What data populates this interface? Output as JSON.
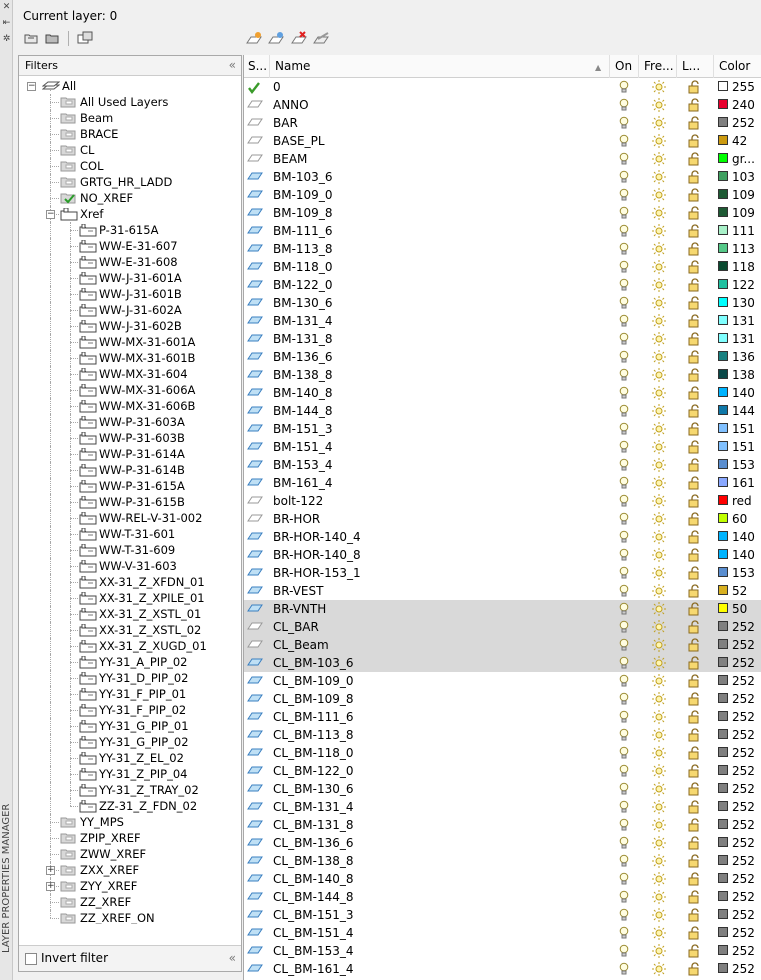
{
  "panel_title": "LAYER PROPERTIES MANAGER",
  "current_layer": "Current layer: 0",
  "filters": {
    "header": "Filters",
    "invert_filter": "Invert filter",
    "items": [
      {
        "label": "All",
        "level": 0,
        "icon": "layer-stack-icon",
        "expander": "minus"
      },
      {
        "label": "All Used Layers",
        "level": 1,
        "icon": "filter-folder-icon"
      },
      {
        "label": "Beam",
        "level": 1,
        "icon": "filter-folder-icon"
      },
      {
        "label": "BRACE",
        "level": 1,
        "icon": "filter-folder-icon"
      },
      {
        "label": "CL",
        "level": 1,
        "icon": "filter-folder-icon"
      },
      {
        "label": "COL",
        "level": 1,
        "icon": "filter-folder-icon"
      },
      {
        "label": "GRTG_HR_LADD",
        "level": 1,
        "icon": "filter-folder-icon"
      },
      {
        "label": "NO_XREF",
        "level": 1,
        "icon": "filter-folder-check-icon"
      },
      {
        "label": "Xref",
        "level": 1,
        "icon": "xref-folder-icon",
        "expander": "minus"
      },
      {
        "label": "P-31-615A",
        "level": 2,
        "icon": "xref-icon"
      },
      {
        "label": "WW-E-31-607",
        "level": 2,
        "icon": "xref-icon"
      },
      {
        "label": "WW-E-31-608",
        "level": 2,
        "icon": "xref-icon"
      },
      {
        "label": "WW-J-31-601A",
        "level": 2,
        "icon": "xref-icon"
      },
      {
        "label": "WW-J-31-601B",
        "level": 2,
        "icon": "xref-icon"
      },
      {
        "label": "WW-J-31-602A",
        "level": 2,
        "icon": "xref-icon"
      },
      {
        "label": "WW-J-31-602B",
        "level": 2,
        "icon": "xref-icon"
      },
      {
        "label": "WW-MX-31-601A",
        "level": 2,
        "icon": "xref-icon"
      },
      {
        "label": "WW-MX-31-601B",
        "level": 2,
        "icon": "xref-icon"
      },
      {
        "label": "WW-MX-31-604",
        "level": 2,
        "icon": "xref-icon"
      },
      {
        "label": "WW-MX-31-606A",
        "level": 2,
        "icon": "xref-icon"
      },
      {
        "label": "WW-MX-31-606B",
        "level": 2,
        "icon": "xref-icon"
      },
      {
        "label": "WW-P-31-603A",
        "level": 2,
        "icon": "xref-icon"
      },
      {
        "label": "WW-P-31-603B",
        "level": 2,
        "icon": "xref-icon"
      },
      {
        "label": "WW-P-31-614A",
        "level": 2,
        "icon": "xref-icon"
      },
      {
        "label": "WW-P-31-614B",
        "level": 2,
        "icon": "xref-icon"
      },
      {
        "label": "WW-P-31-615A",
        "level": 2,
        "icon": "xref-icon"
      },
      {
        "label": "WW-P-31-615B",
        "level": 2,
        "icon": "xref-icon"
      },
      {
        "label": "WW-REL-V-31-002",
        "level": 2,
        "icon": "xref-icon"
      },
      {
        "label": "WW-T-31-601",
        "level": 2,
        "icon": "xref-icon"
      },
      {
        "label": "WW-T-31-609",
        "level": 2,
        "icon": "xref-icon"
      },
      {
        "label": "WW-V-31-603",
        "level": 2,
        "icon": "xref-icon"
      },
      {
        "label": "XX-31_Z_XFDN_01",
        "level": 2,
        "icon": "xref-icon"
      },
      {
        "label": "XX-31_Z_XPILE_01",
        "level": 2,
        "icon": "xref-icon"
      },
      {
        "label": "XX-31_Z_XSTL_01",
        "level": 2,
        "icon": "xref-icon"
      },
      {
        "label": "XX-31_Z_XSTL_02",
        "level": 2,
        "icon": "xref-icon"
      },
      {
        "label": "XX-31_Z_XUGD_01",
        "level": 2,
        "icon": "xref-icon"
      },
      {
        "label": "YY-31_A_PIP_02",
        "level": 2,
        "icon": "xref-icon"
      },
      {
        "label": "YY-31_D_PIP_02",
        "level": 2,
        "icon": "xref-icon"
      },
      {
        "label": "YY-31_F_PIP_01",
        "level": 2,
        "icon": "xref-icon"
      },
      {
        "label": "YY-31_F_PIP_02",
        "level": 2,
        "icon": "xref-icon"
      },
      {
        "label": "YY-31_G_PIP_01",
        "level": 2,
        "icon": "xref-icon"
      },
      {
        "label": "YY-31_G_PIP_02",
        "level": 2,
        "icon": "xref-icon"
      },
      {
        "label": "YY-31_Z_EL_02",
        "level": 2,
        "icon": "xref-icon"
      },
      {
        "label": "YY-31_Z_PIP_04",
        "level": 2,
        "icon": "xref-icon"
      },
      {
        "label": "YY-31_Z_TRAY_02",
        "level": 2,
        "icon": "xref-icon"
      },
      {
        "label": "ZZ-31_Z_FDN_02",
        "level": 2,
        "icon": "xref-icon"
      },
      {
        "label": "YY_MPS",
        "level": 1,
        "icon": "filter-folder-icon"
      },
      {
        "label": "ZPIP_XREF",
        "level": 1,
        "icon": "filter-folder-icon"
      },
      {
        "label": "ZWW_XREF",
        "level": 1,
        "icon": "filter-folder-icon"
      },
      {
        "label": "ZXX_XREF",
        "level": 1,
        "icon": "filter-folder-icon",
        "expander": "plus"
      },
      {
        "label": "ZYY_XREF",
        "level": 1,
        "icon": "filter-folder-icon",
        "expander": "plus"
      },
      {
        "label": "ZZ_XREF",
        "level": 1,
        "icon": "filter-folder-icon"
      },
      {
        "label": "ZZ_XREF_ON",
        "level": 1,
        "icon": "filter-folder-icon"
      }
    ]
  },
  "columns": {
    "status": "S...",
    "name": "Name",
    "on": "On",
    "freeze": "Fre...",
    "lock": "L...",
    "color": "Color"
  },
  "layers": [
    {
      "status": "current",
      "name": "0",
      "color": "255",
      "hex": "#ffffff"
    },
    {
      "status": "unused",
      "name": "ANNO",
      "color": "240",
      "hex": "#e8002e"
    },
    {
      "status": "unused",
      "name": "BAR",
      "color": "252",
      "hex": "#808080"
    },
    {
      "status": "unused",
      "name": "BASE_PL",
      "color": "42",
      "hex": "#cc9a10"
    },
    {
      "status": "unused",
      "name": "BEAM",
      "color": "gr...",
      "hex": "#00ff00"
    },
    {
      "status": "used",
      "name": "BM-103_6",
      "color": "103",
      "hex": "#3fa060"
    },
    {
      "status": "used",
      "name": "BM-109_0",
      "color": "109",
      "hex": "#1e5a34"
    },
    {
      "status": "used",
      "name": "BM-109_8",
      "color": "109",
      "hex": "#1e5a34"
    },
    {
      "status": "used",
      "name": "BM-111_6",
      "color": "111",
      "hex": "#a8f0c8"
    },
    {
      "status": "used",
      "name": "BM-113_8",
      "color": "113",
      "hex": "#55c888"
    },
    {
      "status": "used",
      "name": "BM-118_0",
      "color": "118",
      "hex": "#0a4a30"
    },
    {
      "status": "used",
      "name": "BM-122_0",
      "color": "122",
      "hex": "#20c0a0"
    },
    {
      "status": "used",
      "name": "BM-130_6",
      "color": "130",
      "hex": "#00ffff"
    },
    {
      "status": "used",
      "name": "BM-131_4",
      "color": "131",
      "hex": "#80ffff"
    },
    {
      "status": "used",
      "name": "BM-131_8",
      "color": "131",
      "hex": "#80ffff"
    },
    {
      "status": "used",
      "name": "BM-136_6",
      "color": "136",
      "hex": "#188080"
    },
    {
      "status": "used",
      "name": "BM-138_8",
      "color": "138",
      "hex": "#0a4848"
    },
    {
      "status": "used",
      "name": "BM-140_8",
      "color": "140",
      "hex": "#00b4ff"
    },
    {
      "status": "used",
      "name": "BM-144_8",
      "color": "144",
      "hex": "#1078a8"
    },
    {
      "status": "used",
      "name": "BM-151_3",
      "color": "151",
      "hex": "#80c0ff"
    },
    {
      "status": "used",
      "name": "BM-151_4",
      "color": "151",
      "hex": "#80c0ff"
    },
    {
      "status": "used",
      "name": "BM-153_4",
      "color": "153",
      "hex": "#5a8ed0"
    },
    {
      "status": "used",
      "name": "BM-161_4",
      "color": "161",
      "hex": "#8aa8ff"
    },
    {
      "status": "unused",
      "name": "bolt-122",
      "color": "red",
      "hex": "#ff0000"
    },
    {
      "status": "unused",
      "name": "BR-HOR",
      "color": "60",
      "hex": "#c0ff00"
    },
    {
      "status": "used",
      "name": "BR-HOR-140_4",
      "color": "140",
      "hex": "#00b4ff"
    },
    {
      "status": "used",
      "name": "BR-HOR-140_8",
      "color": "140",
      "hex": "#00b4ff"
    },
    {
      "status": "used",
      "name": "BR-HOR-153_1",
      "color": "153",
      "hex": "#5a8ed0"
    },
    {
      "status": "used",
      "name": "BR-VEST",
      "color": "52",
      "hex": "#d8b020"
    },
    {
      "status": "used",
      "name": "BR-VNTH",
      "color": "50",
      "hex": "#ffff00",
      "selected": true
    },
    {
      "status": "unused",
      "name": "CL_BAR",
      "color": "252",
      "hex": "#808080",
      "selected": true
    },
    {
      "status": "unused",
      "name": "CL_Beam",
      "color": "252",
      "hex": "#808080",
      "selected": true
    },
    {
      "status": "used",
      "name": "CL_BM-103_6",
      "color": "252",
      "hex": "#808080",
      "selected": true
    },
    {
      "status": "used",
      "name": "CL_BM-109_0",
      "color": "252",
      "hex": "#808080"
    },
    {
      "status": "used",
      "name": "CL_BM-109_8",
      "color": "252",
      "hex": "#808080"
    },
    {
      "status": "used",
      "name": "CL_BM-111_6",
      "color": "252",
      "hex": "#808080"
    },
    {
      "status": "used",
      "name": "CL_BM-113_8",
      "color": "252",
      "hex": "#808080"
    },
    {
      "status": "used",
      "name": "CL_BM-118_0",
      "color": "252",
      "hex": "#808080"
    },
    {
      "status": "used",
      "name": "CL_BM-122_0",
      "color": "252",
      "hex": "#808080"
    },
    {
      "status": "used",
      "name": "CL_BM-130_6",
      "color": "252",
      "hex": "#808080"
    },
    {
      "status": "used",
      "name": "CL_BM-131_4",
      "color": "252",
      "hex": "#808080"
    },
    {
      "status": "used",
      "name": "CL_BM-131_8",
      "color": "252",
      "hex": "#808080"
    },
    {
      "status": "used",
      "name": "CL_BM-136_6",
      "color": "252",
      "hex": "#808080"
    },
    {
      "status": "used",
      "name": "CL_BM-138_8",
      "color": "252",
      "hex": "#808080"
    },
    {
      "status": "used",
      "name": "CL_BM-140_8",
      "color": "252",
      "hex": "#808080"
    },
    {
      "status": "used",
      "name": "CL_BM-144_8",
      "color": "252",
      "hex": "#808080"
    },
    {
      "status": "used",
      "name": "CL_BM-151_3",
      "color": "252",
      "hex": "#808080"
    },
    {
      "status": "used",
      "name": "CL_BM-151_4",
      "color": "252",
      "hex": "#808080"
    },
    {
      "status": "used",
      "name": "CL_BM-153_4",
      "color": "252",
      "hex": "#808080"
    },
    {
      "status": "used",
      "name": "CL_BM-161_4",
      "color": "252",
      "hex": "#808080"
    }
  ]
}
